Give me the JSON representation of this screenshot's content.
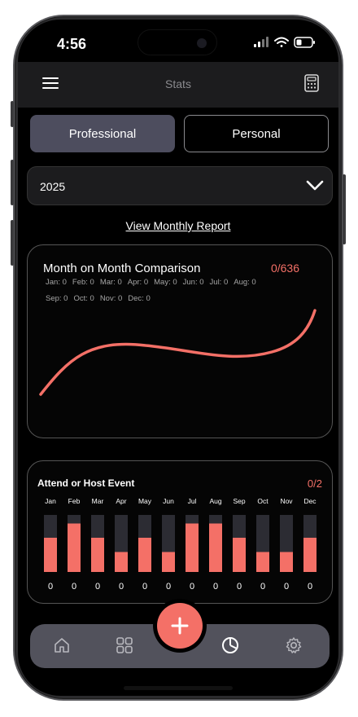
{
  "status": {
    "time": "4:56"
  },
  "header": {
    "title": "Stats",
    "menu_icon": "hamburger-menu-icon",
    "calculator_icon": "calculator-icon"
  },
  "tabs": [
    {
      "label": "Professional",
      "active": true
    },
    {
      "label": "Personal",
      "active": false
    }
  ],
  "year_select": {
    "value": "2025"
  },
  "report_link": "View Monthly Report",
  "line_card": {
    "title": "Month on Month Comparison",
    "count": "0/636",
    "months": [
      "Jan: 0",
      "Feb: 0",
      "Mar: 0",
      "Apr: 0",
      "May: 0",
      "Jun: 0",
      "Jul: 0",
      "Aug: 0",
      "Sep: 0",
      "Oct: 0",
      "Nov: 0",
      "Dec: 0"
    ]
  },
  "bar_card": {
    "title": "Attend or Host Event",
    "count": "0/2"
  },
  "chart_data": {
    "type": "bar",
    "title": "Attend or Host Event",
    "categories": [
      "Jan",
      "Feb",
      "Mar",
      "Apr",
      "May",
      "Jun",
      "Jul",
      "Aug",
      "Sep",
      "Oct",
      "Nov",
      "Dec"
    ],
    "values": [
      0,
      0,
      0,
      0,
      0,
      0,
      0,
      0,
      0,
      0,
      0,
      0
    ],
    "bar_fill": [
      0.6,
      0.85,
      0.6,
      0.35,
      0.6,
      0.35,
      0.85,
      0.85,
      0.6,
      0.35,
      0.35,
      0.6
    ],
    "colors": {
      "bar": "#f47067",
      "track": "#2c2c33"
    }
  },
  "nav": {
    "items": [
      {
        "icon": "home-icon"
      },
      {
        "icon": "grid-icon"
      },
      {
        "icon": "pie-chart-icon",
        "active": true
      },
      {
        "icon": "gear-icon"
      }
    ],
    "fab_icon": "plus-icon"
  },
  "colors": {
    "accent": "#f47067",
    "tab_active": "#4d4d5e",
    "nav_bg": "#52525c"
  }
}
